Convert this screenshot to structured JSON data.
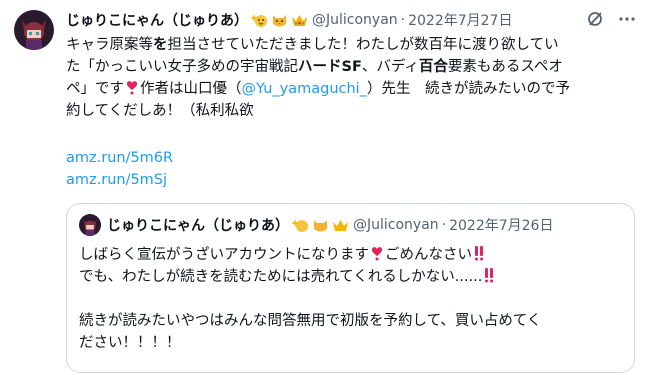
{
  "tweet": {
    "display_name": "じゅりこにゃん（じゅりあ）",
    "handle": "@Juliconyan",
    "separator": "·",
    "date": "2022年7月27日",
    "text": {
      "l1": "キャラ原案等",
      "l1b": "を",
      "l1c": "担当させていただきました！わたしが数百年に渡り欲してい",
      "l2a": "た「かっこいい女子多めの宇宙戦記",
      "l2b": "ハードSF",
      "l2c": "、バディ",
      "l2d": "百合",
      "l2e": "要素もあるスペオ",
      "l3a": "ペ」です",
      "l3b": "作者は山口優（",
      "l3mention": "@Yu_yamaguchi_",
      "l3c": "）先生　続きが読みたいので予",
      "l4": "約してくだしあ！（私利私欲"
    },
    "links": [
      "amz.run/5m6R",
      "amz.run/5mSj"
    ],
    "badges": [
      "sparkle-face-emoji",
      "cat-emoji",
      "crown-emoji"
    ]
  },
  "quote": {
    "display_name": "じゅりこにゃん（じゅりあ）",
    "handle": "@Juliconyan",
    "separator": "·",
    "date": "2022年7月26日",
    "l1a": "しばらく宣伝がうざいアカウントになります",
    "l1b": "ごめんなさい",
    "l2a": "でも、わたしが続きを読むためには売れてくれるしかない......",
    "l4": "続きが読みたいやつはみんな問答無用で初版を予約して、買い占めてく",
    "l5": "ださい！！！！"
  },
  "colors": {
    "link": "#1d9bf0",
    "muted": "#536471",
    "border": "#cfd9de",
    "heart": "#e0245e"
  }
}
